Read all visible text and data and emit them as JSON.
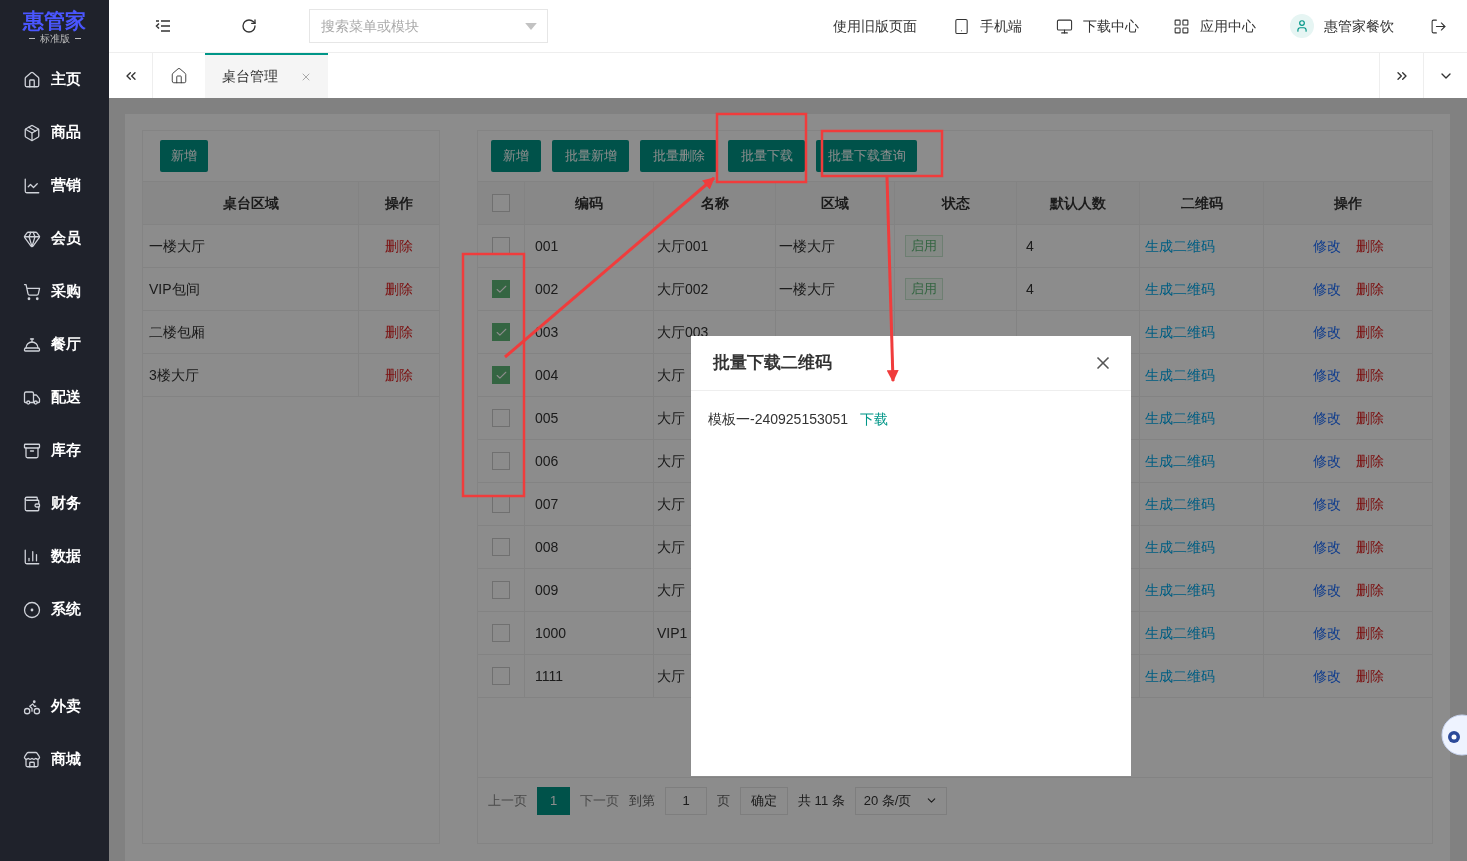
{
  "sidebar": {
    "logo": "惠管家",
    "edition": "标准版",
    "items": [
      {
        "label": "主页"
      },
      {
        "label": "商品"
      },
      {
        "label": "营销"
      },
      {
        "label": "会员"
      },
      {
        "label": "采购"
      },
      {
        "label": "餐厅"
      },
      {
        "label": "配送"
      },
      {
        "label": "库存"
      },
      {
        "label": "财务"
      },
      {
        "label": "数据"
      },
      {
        "label": "系统"
      }
    ],
    "extra_items": [
      {
        "label": "外卖"
      },
      {
        "label": "商城"
      }
    ]
  },
  "header": {
    "search": {
      "placeholder": "搜索菜单或模块"
    },
    "old_version_link": "使用旧版页面",
    "links": [
      {
        "label": "手机端"
      },
      {
        "label": "下载中心"
      },
      {
        "label": "应用中心"
      }
    ],
    "user": "惠管家餐饮"
  },
  "tabs": [
    {
      "label": "桌台管理",
      "selected": true
    }
  ],
  "area_panel": {
    "add_button": "新增",
    "columns": [
      "桌台区域",
      "操作"
    ],
    "rows": [
      {
        "area": "一楼大厅",
        "action": "删除"
      },
      {
        "area": "VIP包间",
        "action": "删除"
      },
      {
        "area": "二楼包厢",
        "action": "删除"
      },
      {
        "area": "3楼大厅",
        "action": "删除"
      }
    ]
  },
  "table_panel": {
    "buttons": [
      "新增",
      "批量新增",
      "批量删除",
      "批量下载",
      "批量下载查询"
    ],
    "select_all_checked": false,
    "columns": [
      "编码",
      "名称",
      "区域",
      "状态",
      "默认人数",
      "二维码",
      "操作"
    ],
    "rows": [
      {
        "code": "001",
        "name": "大厅001",
        "area": "一楼大厅",
        "status": "启用",
        "people": "4",
        "qr": "生成二维码",
        "edit": "修改",
        "delete": "删除",
        "checked": false
      },
      {
        "code": "002",
        "name": "大厅002",
        "area": "一楼大厅",
        "status": "启用",
        "people": "4",
        "qr": "生成二维码",
        "edit": "修改",
        "delete": "删除",
        "checked": true
      },
      {
        "code": "003",
        "name": "大厅003",
        "qr": "生成二维码",
        "edit": "修改",
        "delete": "删除",
        "checked": true
      },
      {
        "code": "004",
        "name": "大厅",
        "qr": "生成二维码",
        "edit": "修改",
        "delete": "删除",
        "checked": true
      },
      {
        "code": "005",
        "name": "大厅",
        "qr": "生成二维码",
        "edit": "修改",
        "delete": "删除",
        "checked": false
      },
      {
        "code": "006",
        "name": "大厅",
        "qr": "生成二维码",
        "edit": "修改",
        "delete": "删除",
        "checked": false
      },
      {
        "code": "007",
        "name": "大厅",
        "qr": "生成二维码",
        "edit": "修改",
        "delete": "删除",
        "checked": false
      },
      {
        "code": "008",
        "name": "大厅",
        "qr": "生成二维码",
        "edit": "修改",
        "delete": "删除",
        "checked": false
      },
      {
        "code": "009",
        "name": "大厅",
        "qr": "生成二维码",
        "edit": "修改",
        "delete": "删除",
        "checked": false
      },
      {
        "code": "1000",
        "name": "VIP1",
        "qr": "生成二维码",
        "edit": "修改",
        "delete": "删除",
        "checked": false
      },
      {
        "code": "1111",
        "name": "大厅",
        "qr": "生成二维码",
        "edit": "修改",
        "delete": "删除",
        "checked": false
      }
    ],
    "pagination": {
      "prev": "上一页",
      "pages": [
        {
          "label": "1",
          "selected": true
        }
      ],
      "next": "下一页",
      "goto_label": "到第",
      "page_input": "1",
      "page_unit": "页",
      "confirm": "确定",
      "total": "共 11 条",
      "page_size": "20 条/页"
    }
  },
  "dialog": {
    "title": "批量下载二维码",
    "items": [
      {
        "name": "模板一-240925153051",
        "action": "下载"
      }
    ]
  }
}
